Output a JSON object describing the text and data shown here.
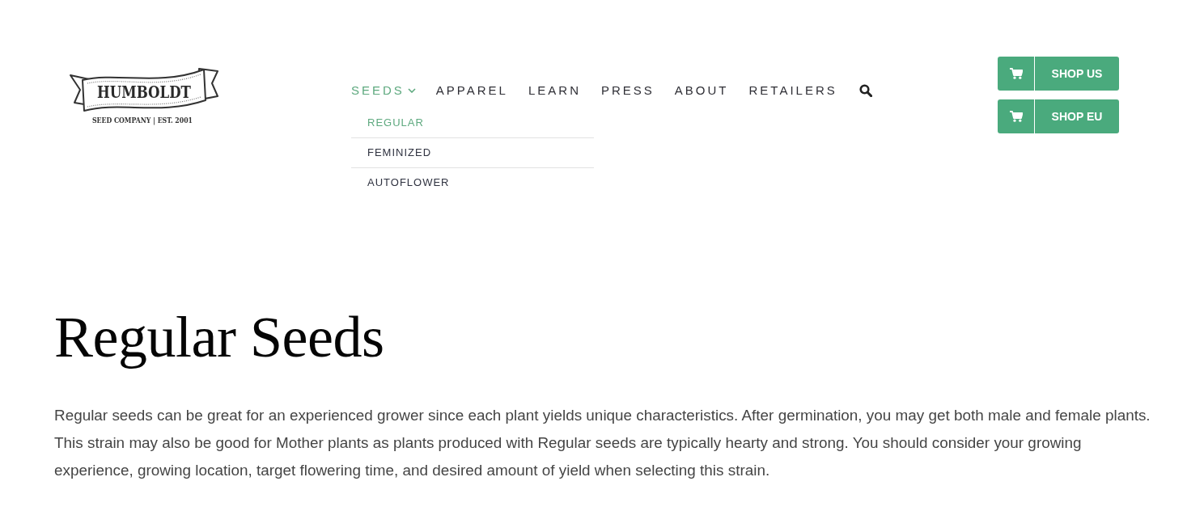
{
  "logo": {
    "wordmark": "HUMBOLDT",
    "tagline": "SEED COMPANY | EST. 2001"
  },
  "nav": {
    "items": [
      {
        "label": "SEEDS",
        "kind": "dropdown",
        "selected": true,
        "expanded": true,
        "submenu": [
          {
            "label": "REGULAR",
            "selected": true
          },
          {
            "label": "FEMINIZED",
            "selected": false
          },
          {
            "label": "AUTOFLOWER",
            "selected": false
          }
        ]
      },
      {
        "label": "APPAREL",
        "kind": "link",
        "selected": false
      },
      {
        "label": "LEARN",
        "kind": "link",
        "selected": false
      },
      {
        "label": "PRESS",
        "kind": "link",
        "selected": false
      },
      {
        "label": "ABOUT",
        "kind": "link",
        "selected": false
      },
      {
        "label": "RETAILERS",
        "kind": "link",
        "selected": false
      }
    ]
  },
  "shop_buttons": [
    {
      "label": "SHOP US"
    },
    {
      "label": "SHOP EU"
    }
  ],
  "page": {
    "title": "Regular Seeds",
    "description": "Regular seeds can be great for an experienced grower since each plant yields unique characteristics. After germination, you may get both male and female plants. This strain may also be good for Mother plants as plants produced with Regular seeds are typically hearty and strong. You should consider your growing experience, growing location, target flowering time, and desired amount of yield when selecting this strain."
  }
}
